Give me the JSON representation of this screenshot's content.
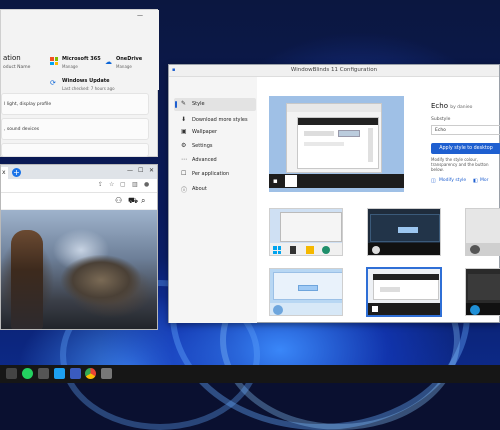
{
  "settings": {
    "profile_name": "ation",
    "profile_sub": "oduct Name",
    "quick_items": [
      {
        "title": "Microsoft 365",
        "sub": "Manage"
      },
      {
        "title": "OneDrive",
        "sub": "Manage"
      },
      {
        "title": "Windows Update",
        "sub": "Last checked: 7 hours ago"
      }
    ],
    "cards": [
      {
        "label": "l light, display profile"
      },
      {
        "label": ", sound devices"
      },
      {
        "label": ""
      }
    ]
  },
  "browser": {
    "new_tab_label": "+",
    "close_tab_label": "x"
  },
  "wb": {
    "title": "WindowBlinds 11 Configuration",
    "nav": [
      {
        "label": "Style",
        "selected": true,
        "icon": "brush-icon",
        "glyph": "✎"
      },
      {
        "label": "Download more styles",
        "selected": false,
        "icon": "download-icon",
        "glyph": "⬇"
      },
      {
        "label": "Wallpaper",
        "selected": false,
        "icon": "image-icon",
        "glyph": "▣"
      },
      {
        "label": "Settings",
        "selected": false,
        "icon": "gear-icon",
        "glyph": "⚙"
      },
      {
        "label": "Advanced",
        "selected": false,
        "icon": "more-icon",
        "glyph": "⋯"
      },
      {
        "label": "Per application",
        "selected": false,
        "icon": "window-icon",
        "glyph": "☐"
      },
      {
        "label": "About",
        "selected": false,
        "icon": "info-icon",
        "glyph": "ⓘ"
      }
    ],
    "style_name": "Echo",
    "style_author": "by danieo",
    "substyle_label": "Substyle",
    "substyle_value": "Echo",
    "apply_button": "Apply style to desktop",
    "description": "Modify the style colour, transparency and the button below.",
    "modify_link": "Modify style",
    "more_link": "Mor"
  },
  "colors": {
    "accent": "#1e5fd0",
    "taskbar": "#161616"
  }
}
